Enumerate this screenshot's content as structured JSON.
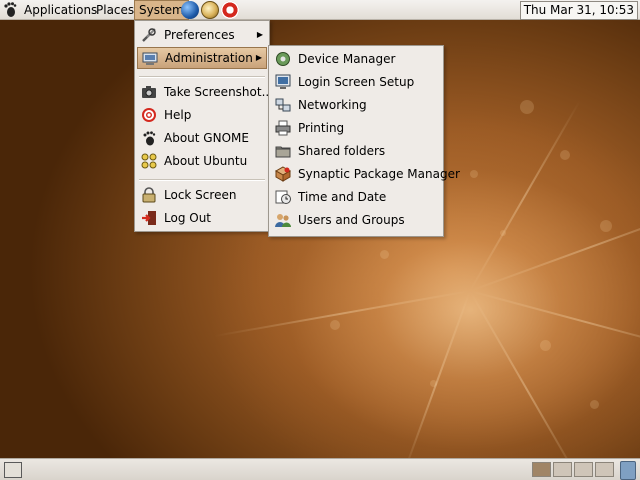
{
  "top_panel": {
    "menus": [
      "Applications",
      "Places",
      "System"
    ],
    "clock": "Thu Mar 31, 10:53"
  },
  "system_menu": {
    "items": [
      {
        "label": "Preferences",
        "icon": "preferences-icon",
        "submenu": true
      },
      {
        "label": "Administration",
        "icon": "administration-icon",
        "submenu": true,
        "highlighted": true
      },
      {
        "label": "Take Screenshot...",
        "icon": "camera-icon"
      },
      {
        "label": "Help",
        "icon": "help-icon"
      },
      {
        "label": "About GNOME",
        "icon": "gnome-foot-icon"
      },
      {
        "label": "About Ubuntu",
        "icon": "ubuntu-icon"
      },
      {
        "label": "Lock Screen",
        "icon": "lock-icon"
      },
      {
        "label": "Log Out",
        "icon": "logout-icon"
      }
    ]
  },
  "administration_menu": {
    "items": [
      {
        "label": "Device Manager",
        "icon": "device-manager-icon"
      },
      {
        "label": "Login Screen Setup",
        "icon": "login-screen-icon"
      },
      {
        "label": "Networking",
        "icon": "network-icon"
      },
      {
        "label": "Printing",
        "icon": "printer-icon"
      },
      {
        "label": "Shared folders",
        "icon": "shared-folder-icon"
      },
      {
        "label": "Synaptic Package Manager",
        "icon": "synaptic-icon"
      },
      {
        "label": "Time and Date",
        "icon": "clock-icon"
      },
      {
        "label": "Users and Groups",
        "icon": "users-icon"
      }
    ]
  },
  "colors": {
    "menu_bg": "#efebe7",
    "highlight": "#c9a27a",
    "desktop_accent": "#c27b3b"
  }
}
